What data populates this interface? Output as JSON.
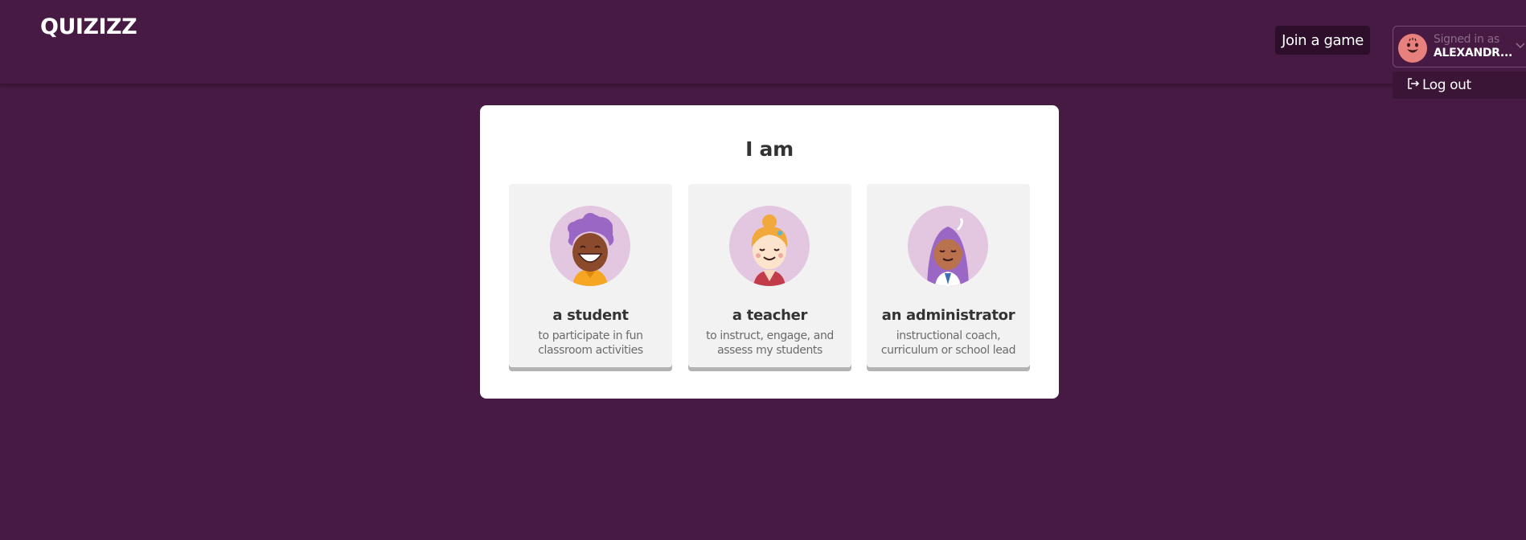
{
  "brand": {
    "logo_text": "QUIZIZZ"
  },
  "header": {
    "join_label": "Join a game",
    "signed_in_label": "Signed in as",
    "user_name": "ALEXANDR...",
    "logout_label": "Log out"
  },
  "main": {
    "title": "I am",
    "roles": [
      {
        "title": "a student",
        "desc_line1": "to participate in fun",
        "desc_line2": "classroom activities"
      },
      {
        "title": "a teacher",
        "desc_line1": "to instruct, engage, and",
        "desc_line2": "assess my students"
      },
      {
        "title": "an administrator",
        "desc_line1": "instructional coach,",
        "desc_line2": "curriculum or school lead"
      }
    ]
  },
  "colors": {
    "background": "#461a42",
    "card": "#ffffff",
    "role_tile": "#f2f2f2",
    "avatar_bg": "#e3c6e0",
    "button_dark": "#2e0f2b"
  },
  "icons": {
    "logo": "quizizz-logo",
    "chevron": "chevron-down-icon",
    "logout": "logout-icon",
    "user_avatar": "user-avatar-icon"
  }
}
